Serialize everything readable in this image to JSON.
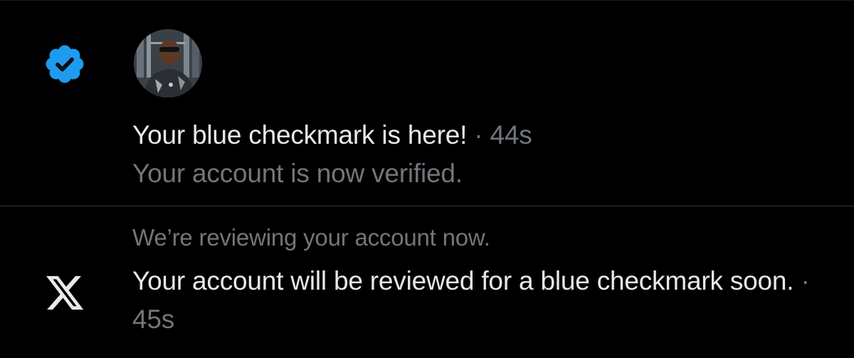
{
  "colors": {
    "background": "#000000",
    "primary_text": "#e7e9ea",
    "secondary_text": "#71767b",
    "verified_blue": "#1d9bf0",
    "divider": "#2f3336"
  },
  "notifications": [
    {
      "icon": "verified-badge-icon",
      "title": "Your blue checkmark is here!",
      "separator": " · ",
      "time": "44s",
      "body": "Your account is now verified."
    },
    {
      "icon": "x-logo-icon",
      "context": "We’re reviewing your account now.",
      "title": "Your account will be reviewed for a blue checkmark soon.",
      "separator": " · ",
      "time": "45s"
    }
  ]
}
